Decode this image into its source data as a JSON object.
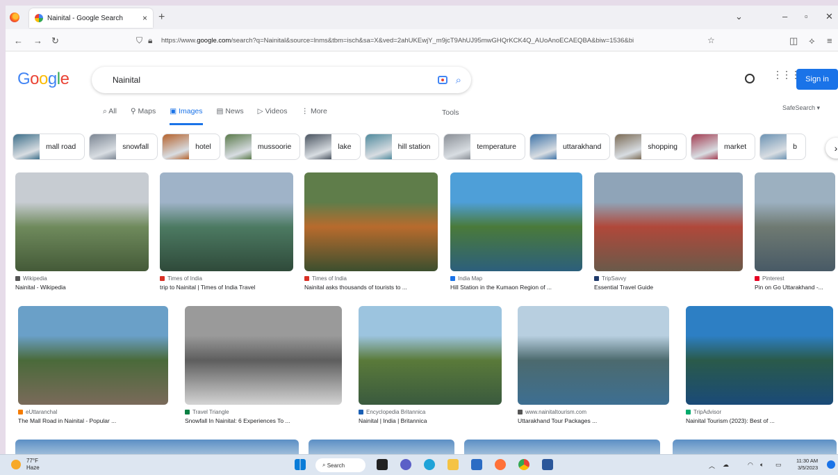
{
  "browser": {
    "tab_title": "Nainital - Google Search",
    "tab_close": "×",
    "new_tab": "+",
    "url_prefix": "https://www.",
    "url_domain": "google.com",
    "url_rest": "/search?q=Nainital&source=lnms&tbm=isch&sa=X&ved=2ahUKEwjY_m9jcT9AhUJ95mwGHQrKCK4Q_AUoAnoECAEQBA&biw=1536&bi"
  },
  "google": {
    "logo_letters": [
      "G",
      "o",
      "o",
      "g",
      "l",
      "e"
    ],
    "query": "Nainital",
    "signin_label": "Sign in",
    "tabs": [
      {
        "label": "All",
        "icon": "⌕"
      },
      {
        "label": "Maps",
        "icon": "⚲"
      },
      {
        "label": "Images",
        "icon": "▣"
      },
      {
        "label": "News",
        "icon": "▤"
      },
      {
        "label": "Videos",
        "icon": "▷"
      },
      {
        "label": "More",
        "icon": "⋮"
      }
    ],
    "tools_label": "Tools",
    "safesearch_label": "SafeSearch ▾"
  },
  "chips": [
    {
      "label": "mall road",
      "color": "#3d6f8a"
    },
    {
      "label": "snowfall",
      "color": "#7c8693"
    },
    {
      "label": "hotel",
      "color": "#b5622c"
    },
    {
      "label": "mussoorie",
      "color": "#5a7a4a"
    },
    {
      "label": "lake",
      "color": "#4a5460"
    },
    {
      "label": "hill station",
      "color": "#4f8a9d"
    },
    {
      "label": "temperature",
      "color": "#8a8f96"
    },
    {
      "label": "uttarakhand",
      "color": "#3f74a8"
    },
    {
      "label": "shopping",
      "color": "#7b6b55"
    },
    {
      "label": "market",
      "color": "#a33d52"
    },
    {
      "label": "b",
      "color": "#6c93b3"
    }
  ],
  "results_row1": [
    {
      "source": "Wikipedia",
      "caption": "Nainital - Wikipedia",
      "src_color": "#555555",
      "img": [
        "#c7ccd2",
        "#6f8a5c",
        "#445a38"
      ]
    },
    {
      "source": "Times of India",
      "caption": "trip to Nainital | Times of India Travel",
      "src_color": "#d93025",
      "img": [
        "#9fb3c8",
        "#4c7a62",
        "#2f4a3a"
      ]
    },
    {
      "source": "Times of India",
      "caption": "Nainital asks thousands of tourists to ...",
      "src_color": "#d93025",
      "img": [
        "#5f7d4a",
        "#b86b2d",
        "#3c4f2e"
      ]
    },
    {
      "source": "India Map",
      "caption": "Hill Station in the Kumaon Region of ...",
      "src_color": "#1a73e8",
      "img": [
        "#4e9fd8",
        "#4a7a3a",
        "#2c5f7c"
      ]
    },
    {
      "source": "TripSavvy",
      "caption": "Essential Travel Guide",
      "src_color": "#1f3a6b",
      "img": [
        "#8fa4b8",
        "#b0483a",
        "#6a5a4a"
      ]
    },
    {
      "source": "Pinterest",
      "caption": "Pin on Go Uttarakhand -...",
      "src_color": "#e60023",
      "img": [
        "#9cb0c0",
        "#6f7a72",
        "#485a66"
      ]
    }
  ],
  "results_row2": [
    {
      "source": "eUttaranchal",
      "caption": "The Mall Road in Nainital - Popular ...",
      "src_color": "#f57c00",
      "img": [
        "#6aa0c8",
        "#4a6a3a",
        "#7a6a5a"
      ]
    },
    {
      "source": "Travel Triangle",
      "caption": "Snowfall In Nainital: 6 Experiences To ...",
      "src_color": "#0b8043",
      "img": [
        "#9a9a9a",
        "#5e5e5e",
        "#d4d4d4"
      ]
    },
    {
      "source": "Encyclopedia Britannica",
      "caption": "Nainital | India | Britannica",
      "src_color": "#1a5fb4",
      "img": [
        "#9cc4df",
        "#5a7a3a",
        "#3a5a3e"
      ]
    },
    {
      "source": "www.nainitaltourism.com",
      "caption": "Uttarakhand Tour Packages ...",
      "src_color": "#555555",
      "img": [
        "#b8cfe0",
        "#4c6a6e",
        "#3d6f92"
      ]
    },
    {
      "source": "TripAdvisor",
      "caption": "Nainital Tourism (2023): Best of ...",
      "src_color": "#00aa6c",
      "img": [
        "#2d7fc4",
        "#2a5a4a",
        "#1a4a78"
      ]
    }
  ],
  "taskbar": {
    "temperature": "77°F",
    "condition": "Haze",
    "search_label": "Search",
    "time": "11:30 AM",
    "date": "3/5/2023"
  }
}
